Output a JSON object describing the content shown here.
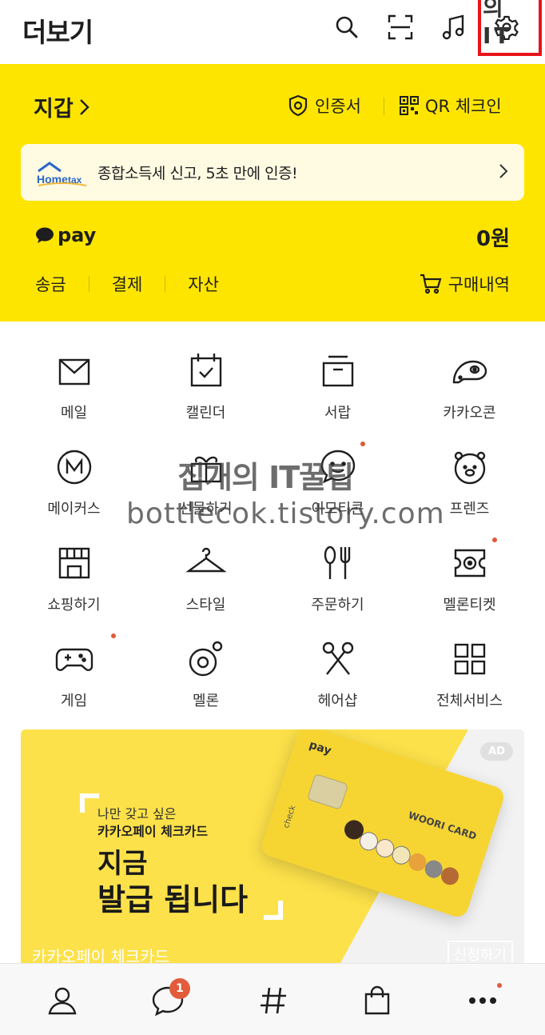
{
  "header": {
    "title": "더보기",
    "watermark_top": "의 IT",
    "icons": [
      "search-icon",
      "scan-icon",
      "music-icon",
      "settings-icon"
    ]
  },
  "wallet": {
    "title": "지갑",
    "certificate_label": "인증서",
    "qr_checkin_label": "QR 체크인",
    "banner": {
      "brand_small": "홈택스",
      "brand": "Hometax",
      "text": "종합소득세 신고, 5초 만에 인증!"
    },
    "pay_label": "pay",
    "balance": "0원",
    "menu": [
      "송금",
      "결제",
      "자산"
    ],
    "orders_label": "구매내역"
  },
  "services": [
    {
      "label": "메일",
      "icon": "mail-icon",
      "dot": false
    },
    {
      "label": "캘린더",
      "icon": "calendar-icon",
      "dot": false
    },
    {
      "label": "서랍",
      "icon": "drawer-icon",
      "dot": false
    },
    {
      "label": "카카오콘",
      "icon": "kakaocon-icon",
      "dot": false
    },
    {
      "label": "메이커스",
      "icon": "makers-icon",
      "dot": false
    },
    {
      "label": "선물하기",
      "icon": "gift-icon",
      "dot": false
    },
    {
      "label": "이모티콘",
      "icon": "emoticon-icon",
      "dot": true
    },
    {
      "label": "프렌즈",
      "icon": "friends-icon",
      "dot": false
    },
    {
      "label": "쇼핑하기",
      "icon": "shop-icon",
      "dot": false
    },
    {
      "label": "스타일",
      "icon": "hanger-icon",
      "dot": false
    },
    {
      "label": "주문하기",
      "icon": "fork-knife-icon",
      "dot": false
    },
    {
      "label": "멜론티켓",
      "icon": "ticket-icon",
      "dot": true
    },
    {
      "label": "게임",
      "icon": "gamepad-icon",
      "dot": true
    },
    {
      "label": "멜론",
      "icon": "melon-icon",
      "dot": false
    },
    {
      "label": "헤어샵",
      "icon": "scissors-icon",
      "dot": false
    },
    {
      "label": "전체서비스",
      "icon": "grid-icon",
      "dot": false
    }
  ],
  "watermark": {
    "line1": "집개의 IT꿀팁",
    "line2": "bottlecok.tistory.com"
  },
  "ad": {
    "badge": "AD",
    "small1": "나만 갖고 싶은",
    "small2": "카카오페이 체크카드",
    "big1": "지금",
    "big2": "발급 됩니다",
    "caption": "카카오페이 체크카드",
    "cta": "신청하기",
    "card_pay": "pay",
    "card_brand": "WOORI CARD",
    "card_check": "check"
  },
  "bottom_nav": {
    "items": [
      "friends-icon",
      "chat-icon",
      "hashtag-icon",
      "shopping-icon",
      "more-icon"
    ],
    "chat_badge": "1"
  },
  "colors": {
    "kakao_yellow": "#fee500",
    "accent_red": "#e25c3c",
    "highlight_red": "#e8131b"
  }
}
